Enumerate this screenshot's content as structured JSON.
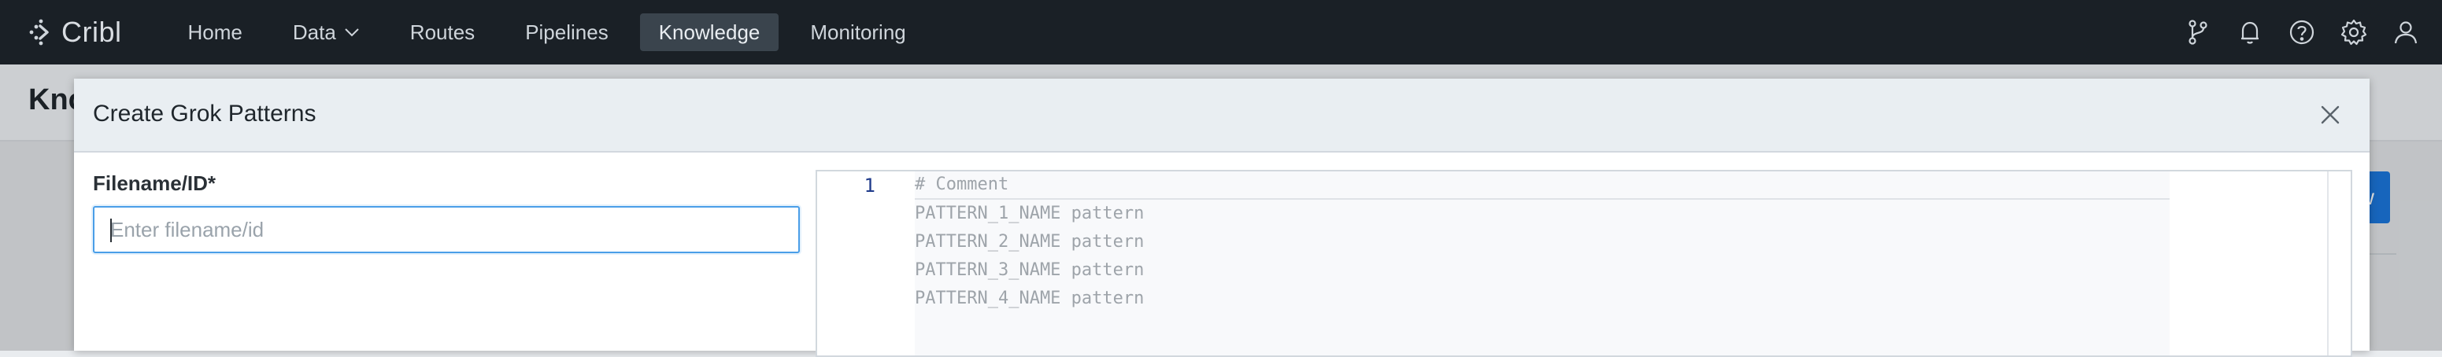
{
  "app": {
    "logo_text": "Cribl"
  },
  "nav": {
    "items": [
      {
        "label": "Home"
      },
      {
        "label": "Data"
      },
      {
        "label": "Routes"
      },
      {
        "label": "Pipelines"
      },
      {
        "label": "Knowledge"
      },
      {
        "label": "Monitoring"
      }
    ],
    "active": "Knowledge",
    "icons": [
      "git-branch-icon",
      "bell-icon",
      "help-icon",
      "gear-icon",
      "user-icon"
    ]
  },
  "background_page": {
    "title_partial": "Kno",
    "button_partial": "ew"
  },
  "modal": {
    "title": "Create Grok Patterns",
    "filename_label": "Filename/ID*",
    "filename_placeholder": "Enter filename/id",
    "filename_value": "",
    "editor": {
      "line_number": "1",
      "placeholder_lines": [
        "# Comment",
        "PATTERN_1_NAME pattern",
        "PATTERN_2_NAME pattern",
        "PATTERN_3_NAME pattern",
        "PATTERN_4_NAME pattern"
      ]
    }
  },
  "colors": {
    "nav_bg": "#1a2026",
    "nav_active_bg": "#3a444d",
    "accent_blue": "#1b74d6",
    "input_focus": "#4a9ee8"
  }
}
